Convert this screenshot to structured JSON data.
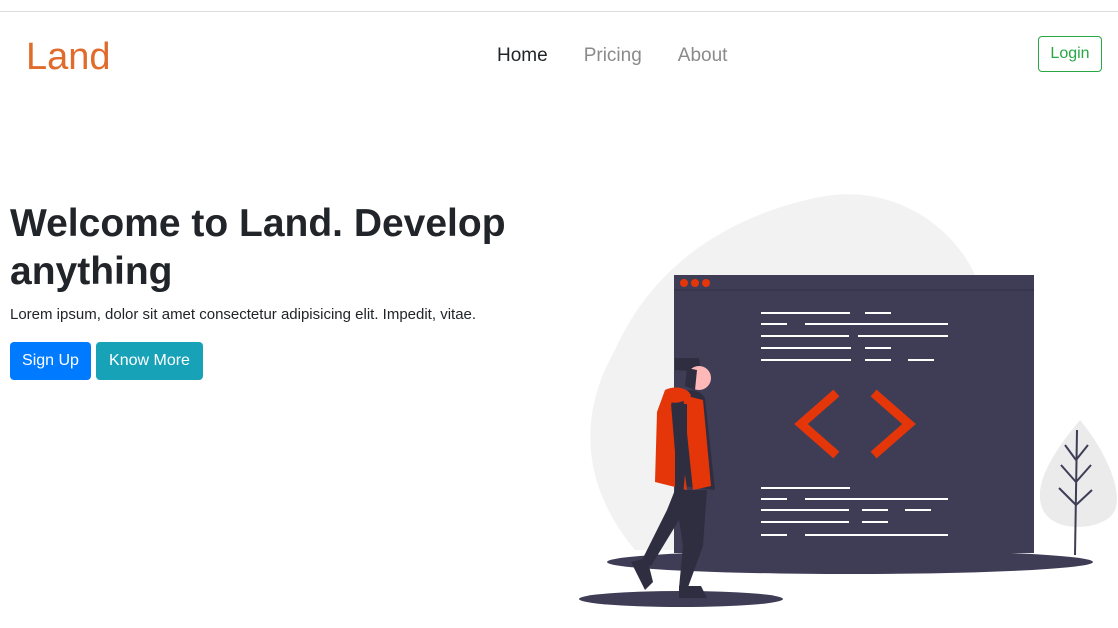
{
  "header": {
    "brand": "Land",
    "nav": [
      {
        "label": "Home",
        "active": true
      },
      {
        "label": "Pricing",
        "active": false
      },
      {
        "label": "About",
        "active": false
      }
    ],
    "login_label": "Login"
  },
  "hero": {
    "title": "Welcome to Land. Develop anything",
    "subtitle": "Lorem ipsum, dolor sit amet consectetur adipisicing elit. Impedit, vitae.",
    "signup_label": "Sign Up",
    "more_label": "Know More"
  },
  "colors": {
    "brand": "#e06c2c",
    "primary": "#007bff",
    "info": "#17a2b8",
    "success": "#28a745",
    "illustration_accent": "#e53609",
    "illustration_dark": "#3f3d56"
  },
  "icons": {
    "illustration": "developer-code-illustration"
  }
}
